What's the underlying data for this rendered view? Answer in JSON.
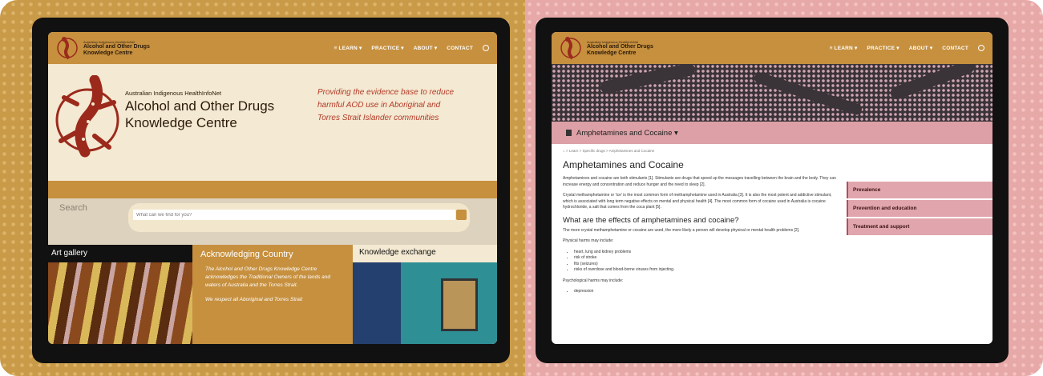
{
  "left": {
    "nav": {
      "brand_small": "Australian Indigenous HealthInfoNet",
      "brand_line1": "Alcohol and Other Drugs",
      "brand_line2": "Knowledge Centre",
      "menu": [
        "≡ LEARN ▾",
        "PRACTICE ▾",
        "ABOUT ▾",
        "CONTACT"
      ]
    },
    "hero": {
      "sub": "Australian Indigenous HealthInfoNet",
      "title_line1": "Alcohol and Other Drugs",
      "title_line2": "Knowledge Centre",
      "tagline": "Providing the evidence base to reduce harmful AOD use in Aboriginal and Torres Strait Islander communities"
    },
    "search": {
      "label": "Search",
      "placeholder": "What can we find for you?"
    },
    "tiles": {
      "gallery": "Art gallery",
      "acknowledging": "Acknowledging Country",
      "ack_text1": "The Alcohol and Other Drugs Knowledge Centre acknowledges the Traditional Owners of the lands and waters of Australia and the Torres Strait.",
      "ack_text2": "We respect all Aboriginal and Torres Strait",
      "exchange": "Knowledge exchange"
    }
  },
  "right": {
    "nav": {
      "brand_small": "Australian Indigenous HealthInfoNet",
      "brand_line1": "Alcohol and Other Drugs",
      "brand_line2": "Knowledge Centre",
      "menu": [
        "≡ LEARN ▾",
        "PRACTICE ▾",
        "ABOUT ▾",
        "CONTACT"
      ]
    },
    "topic": "Amphetamines and Cocaine ▾",
    "breadcrumb": "⌂ > Learn > Specific drugs > Amphetamines and Cocaine",
    "title": "Amphetamines and Cocaine",
    "para1": "Amphetamines and cocaine are both stimulants [1]. Stimulants are drugs that speed up the messages travelling between the brain and the body. They can increase energy and concentration and reduce hunger and the need to sleep [2].",
    "para2": "Crystal methamphetamine or 'ice' is the most common form of methamphetamine used in Australia [3]. It is also the most potent and addictive stimulant, which is associated with long term negative effects on mental and physical health [4]. The most common form of cocaine used in Australia is cocaine hydrochloride, a salt that comes from the coca plant [5].",
    "h2": "What are the effects of amphetamines and cocaine?",
    "para3": "The more crystal methamphetamine or cocaine are used, the more likely a person will develop physical or mental health problems [2].",
    "physical_intro": "Physical harms may include:",
    "physical": [
      "heart, lung and kidney problems",
      "risk of stroke",
      "fits (seizures)",
      "risks of overdose and blood-borne viruses from injecting."
    ],
    "psych_intro": "Psychological harms may include:",
    "psych": [
      "depression"
    ],
    "side": [
      "Prevalence",
      "Prevention and education",
      "Treatment and support"
    ]
  }
}
